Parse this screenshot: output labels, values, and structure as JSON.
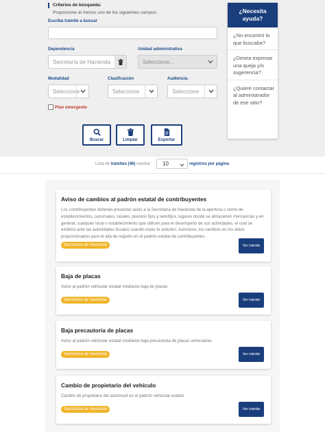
{
  "filters": {
    "section_title": "Criterios de búsqueda:",
    "section_subtitle": "Proporcione al menos uno de los siguientes campos:",
    "search_label": "Escriba trámite a buscar",
    "search_value": "",
    "dependencia_label": "Dependencia",
    "dependencia_value": "Secretaría de Hacienda",
    "unidad_label": "Unidad administrativa",
    "unidad_placeholder": "Seleccione...",
    "modalidad_label": "Modalidad",
    "modalidad_value": "Seleccione",
    "clasificacion_label": "Clasificación",
    "clasificacion_value": "Seleccione",
    "audiencia_label": "Audiencia",
    "audiencia_value": "Seleccione",
    "plan_emergente_label": "Plan emergente",
    "plan_emergente_checked": false
  },
  "actions": {
    "buscar": "Buscar",
    "limpiar": "Limpiar",
    "exportar": "Exportar"
  },
  "help": {
    "title": "¿Necesita ayuda?",
    "items": [
      "¿No encontró lo que buscaba?",
      "¿Desea expresar una queja y/o sugerencia?",
      "¿Quiere contactar al administrador de ese sitio?"
    ]
  },
  "lista": {
    "prefix": "Lista de",
    "tramites_label": "trámites",
    "count": "(46)",
    "mostrar": "mostrar",
    "per_page": "10",
    "registros": "registros por página"
  },
  "tramites": [
    {
      "title": "Aviso de cambios al padrón estatal de contribuyentes",
      "description": "Los contribuyentes deberán presentar aviso a la Secretaría de Hacienda de la apertura o cierre de establecimientos, sucursales, locales, puestos fijos y semifijos, lugares donde se almacenen mercancías y en general, cualquier local o establecimiento que utilicen para el desempeño de sus actividades, el cual se exhibirá ante las autoridades fiscales cuando estas lo soliciten. Asimismo, los cambios en los datos proporcionados para el alta de registro en el padrón estatal de contribuyentes.",
      "badge": "Secretaría de Hacienda",
      "button": "Ver trámite"
    },
    {
      "title": "Baja de placas",
      "description": "Aviso al padrón vehicular estatal mediante baja de placas",
      "badge": "Secretaría de Hacienda",
      "button": "Ver trámite"
    },
    {
      "title": "Baja precautoria de placas",
      "description": "Aviso al padrón vehicular estatal mediante baja precautoria de placas vehiculares",
      "badge": "Secretaría de Hacienda",
      "button": "Ver trámite"
    },
    {
      "title": "Cambio de propietario del vehículo",
      "description": "Cambio de propietario del automovil en el padrón vehicular estatal",
      "badge": "Secretaría de Hacienda",
      "button": "Ver trámite"
    }
  ],
  "colors": {
    "primary": "#1a3d7c",
    "badge": "#f0b428",
    "alert": "#c0392b"
  }
}
